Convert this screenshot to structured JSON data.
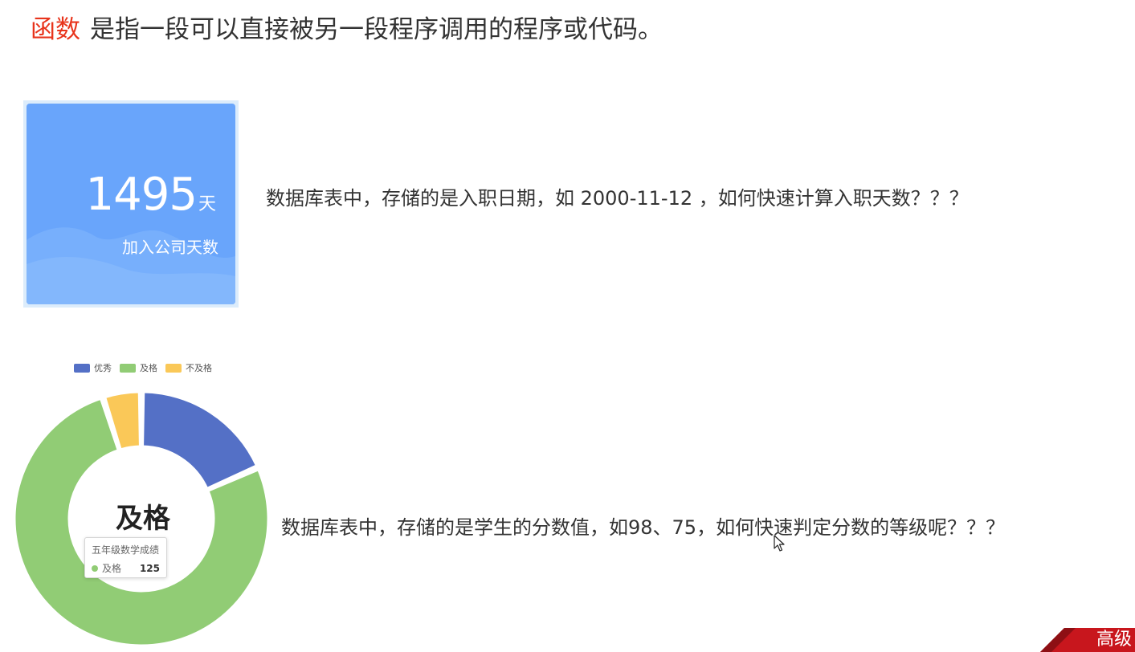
{
  "headline": {
    "keyword": "函数",
    "text": "是指一段可以直接被另一段程序调用的程序或代码。"
  },
  "stat_card": {
    "value": "1495",
    "unit": "天",
    "caption": "加入公司天数"
  },
  "question1": "数据库表中，存储的是入职日期，如 2000-11-12 ，如何快速计算入职天数？？？",
  "question2": "数据库表中，存储的是学生的分数值，如98、75，如何快速判定分数的等级呢？？？",
  "donut": {
    "legend": [
      {
        "label": "优秀",
        "color": "#5470c6"
      },
      {
        "label": "及格",
        "color": "#91cc75"
      },
      {
        "label": "不及格",
        "color": "#fac858"
      }
    ],
    "center_label": "及格",
    "tooltip": {
      "title": "五年级数学成绩",
      "label": "及格",
      "value": "125"
    }
  },
  "chart_data": {
    "type": "pie",
    "variant": "donut",
    "categories": [
      "优秀",
      "及格",
      "不及格"
    ],
    "values": [
      30,
      125,
      8
    ],
    "colors": [
      "#5470c6",
      "#91cc75",
      "#fac858"
    ],
    "legend_position": "top"
  },
  "corner_badge": "高级"
}
